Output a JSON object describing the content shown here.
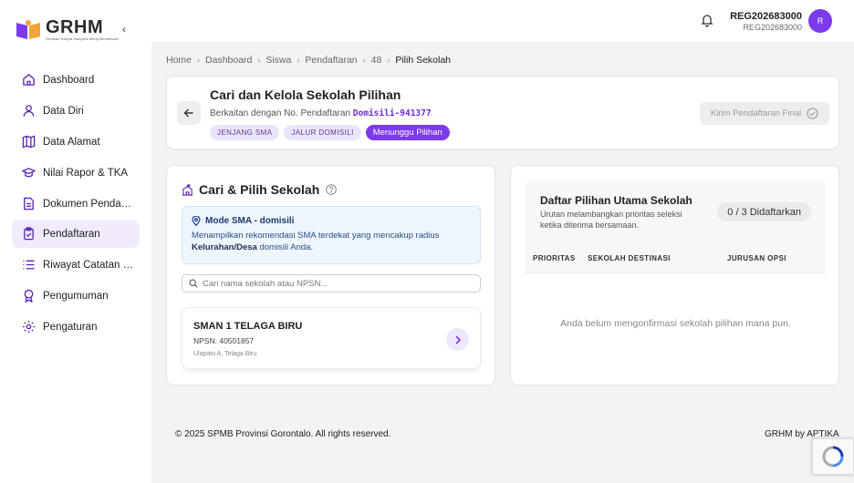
{
  "brand": {
    "name": "GRHM",
    "tagline": "Gerakan Rakyat Hidupkan Mimpi Bersekolah",
    "accent": "#7c3aed"
  },
  "header": {
    "user_name": "REG202683000",
    "user_id": "REG202683000",
    "avatar_initial": "R"
  },
  "sidebar": {
    "items": [
      {
        "label": "Dashboard",
        "icon": "home-icon"
      },
      {
        "label": "Data Diri",
        "icon": "user-icon"
      },
      {
        "label": "Data Alamat",
        "icon": "map-icon"
      },
      {
        "label": "Nilai Rapor & TKA",
        "icon": "graduation-cap-icon"
      },
      {
        "label": "Dokumen Pendaftaran",
        "icon": "document-icon"
      },
      {
        "label": "Pendaftaran",
        "icon": "clipboard-icon",
        "active": true
      },
      {
        "label": "Riwayat Catatan Data",
        "icon": "list-icon"
      },
      {
        "label": "Pengumuman",
        "icon": "award-icon"
      },
      {
        "label": "Pengaturan",
        "icon": "gear-icon"
      }
    ]
  },
  "breadcrumb": [
    "Home",
    "Dashboard",
    "Siswa",
    "Pendaftaran",
    "48",
    "Pilih Sekolah"
  ],
  "page": {
    "title": "Cari dan Kelola Sekolah Pilihan",
    "subtitle_prefix": "Berkaitan dengan No. Pendaftaran",
    "registration_code": "Domisili-941377",
    "chips": [
      "JENJANG SMA",
      "JALUR DOMISILI",
      "Menunggu Pilihan"
    ],
    "final_button": "Kirim Pendaftaran Final"
  },
  "search_panel": {
    "title": "Cari & Pilih Sekolah",
    "info_title": "Mode SMA - domisili",
    "info_text_before": "Menampilkan rekomendasi SMA terdekat yang mencakup radius",
    "info_text_bold": "Kelurahan/Desa",
    "info_text_after": "domisili Anda.",
    "search_placeholder": "Cari nama sekolah atau NPSN...",
    "results": [
      {
        "name": "SMAN 1 TELAGA BIRU",
        "npsn": "NPSN: 40501857",
        "address": "Ulapato A, Telaga Biru"
      }
    ]
  },
  "choices_panel": {
    "title": "Daftar Pilihan Utama Sekolah",
    "subtitle": "Urutan melambangkan prioritas seleksi ketika diterima bersamaan.",
    "count": "0 / 3 Didaftarkan",
    "columns": [
      "PRIORITAS",
      "SEKOLAH DESTINASI",
      "JURUSAN OPSI"
    ],
    "empty_text": "Anda belum mengonfirmasi sekolah pilihan mana pun."
  },
  "footer": {
    "copyright": "© 2025 SPMB Provinsi Gorontalo. All rights reserved.",
    "credit": "GRHM by APTIKA"
  }
}
